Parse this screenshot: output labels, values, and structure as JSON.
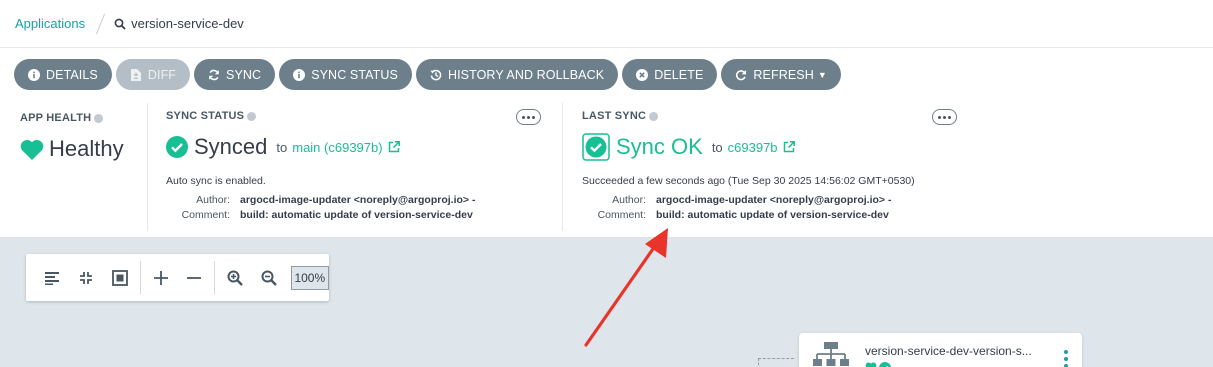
{
  "breadcrumb": {
    "root": "Applications",
    "current": "version-service-dev"
  },
  "toolbar": {
    "details": "DETAILS",
    "diff": "DIFF",
    "sync": "SYNC",
    "sync_status": "SYNC STATUS",
    "history": "HISTORY AND ROLLBACK",
    "delete": "DELETE",
    "refresh": "REFRESH"
  },
  "app_health": {
    "label": "APP HEALTH",
    "value": "Healthy"
  },
  "sync_status": {
    "label": "SYNC STATUS",
    "value": "Synced",
    "to_text": "to",
    "revision": "main (c69397b)",
    "auto_sync": "Auto sync is enabled.",
    "author_label": "Author:",
    "author": "argocd-image-updater <noreply@argoproj.io> -",
    "comment_label": "Comment:",
    "comment": "build: automatic update of version-service-dev"
  },
  "last_sync": {
    "label": "LAST SYNC",
    "value": "Sync OK",
    "to_text": "to",
    "revision": "c69397b",
    "summary": "Succeeded a few seconds ago (Tue Sep 30 2025 14:56:02 GMT+0530)",
    "author_label": "Author:",
    "author": "argocd-image-updater <noreply@argoproj.io> -",
    "comment_label": "Comment:",
    "comment": "build: automatic update of version-service-dev"
  },
  "graph": {
    "zoom": "100%",
    "node_title": "version-service-dev-version-s..."
  },
  "colors": {
    "accent_teal": "#18a1a7",
    "success_green": "#18be94",
    "button_gray": "#6d7f8b",
    "annotation_red": "#e8342a"
  }
}
